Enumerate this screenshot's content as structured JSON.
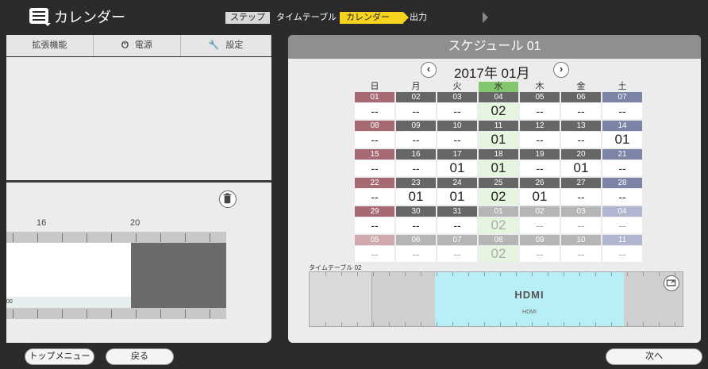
{
  "app": {
    "title": "カレンダー"
  },
  "steps": {
    "label": "ステップ",
    "items": [
      "タイムテーブル",
      "カレンダー",
      "出力"
    ],
    "active_index": 1,
    "accent": "#f5d31f"
  },
  "left_tabs": [
    {
      "label": "拡張機能",
      "icon": ""
    },
    {
      "label": "電源",
      "icon": "power-icon"
    },
    {
      "label": "設定",
      "icon": "wrench-icon"
    }
  ],
  "left_timeline": {
    "hours": [
      "16",
      "20"
    ],
    "row_label": "00"
  },
  "schedule": {
    "title": "スケジュール 01",
    "month": "2017年 01月",
    "weekdays": [
      "日",
      "月",
      "火",
      "水",
      "木",
      "金",
      "土"
    ],
    "today_column": 3,
    "weeks": [
      [
        {
          "d": "01",
          "t": "--"
        },
        {
          "d": "02",
          "t": "--"
        },
        {
          "d": "03",
          "t": "--"
        },
        {
          "d": "04",
          "t": "02"
        },
        {
          "d": "05",
          "t": "--"
        },
        {
          "d": "06",
          "t": "--"
        },
        {
          "d": "07",
          "t": "--"
        }
      ],
      [
        {
          "d": "08",
          "t": "--"
        },
        {
          "d": "09",
          "t": "--"
        },
        {
          "d": "10",
          "t": "--"
        },
        {
          "d": "11",
          "t": "01"
        },
        {
          "d": "12",
          "t": "--"
        },
        {
          "d": "13",
          "t": "--"
        },
        {
          "d": "14",
          "t": "01"
        }
      ],
      [
        {
          "d": "15",
          "t": "--"
        },
        {
          "d": "16",
          "t": "--"
        },
        {
          "d": "17",
          "t": "01"
        },
        {
          "d": "18",
          "t": "01"
        },
        {
          "d": "19",
          "t": "--"
        },
        {
          "d": "20",
          "t": "01"
        },
        {
          "d": "21",
          "t": "--"
        }
      ],
      [
        {
          "d": "22",
          "t": "--"
        },
        {
          "d": "23",
          "t": "01"
        },
        {
          "d": "24",
          "t": "01"
        },
        {
          "d": "25",
          "t": "02"
        },
        {
          "d": "26",
          "t": "01"
        },
        {
          "d": "27",
          "t": "--"
        },
        {
          "d": "28",
          "t": "--"
        }
      ],
      [
        {
          "d": "29",
          "t": "--"
        },
        {
          "d": "30",
          "t": "--"
        },
        {
          "d": "31",
          "t": "--"
        },
        {
          "d": "01",
          "t": "02"
        },
        {
          "d": "02",
          "t": "--"
        },
        {
          "d": "03",
          "t": "--"
        },
        {
          "d": "04",
          "t": "--"
        }
      ],
      [
        {
          "d": "05",
          "t": "--"
        },
        {
          "d": "06",
          "t": "--"
        },
        {
          "d": "07",
          "t": "--"
        },
        {
          "d": "08",
          "t": "02"
        },
        {
          "d": "09",
          "t": "--"
        },
        {
          "d": "10",
          "t": "--"
        },
        {
          "d": "11",
          "t": "--"
        }
      ]
    ],
    "colors": {
      "sunday": "#a66a72",
      "saturday": "#7b83a6",
      "weekday": "#666666",
      "today_header": "#82c76e",
      "dim": "#b5b5b5"
    }
  },
  "timetable": {
    "label": "タイムテーブル 02",
    "input_logo": "HDMI",
    "input_name": "HDMI"
  },
  "buttons": {
    "top_menu": "トップメニュー",
    "back": "戻る",
    "next": "次へ"
  }
}
